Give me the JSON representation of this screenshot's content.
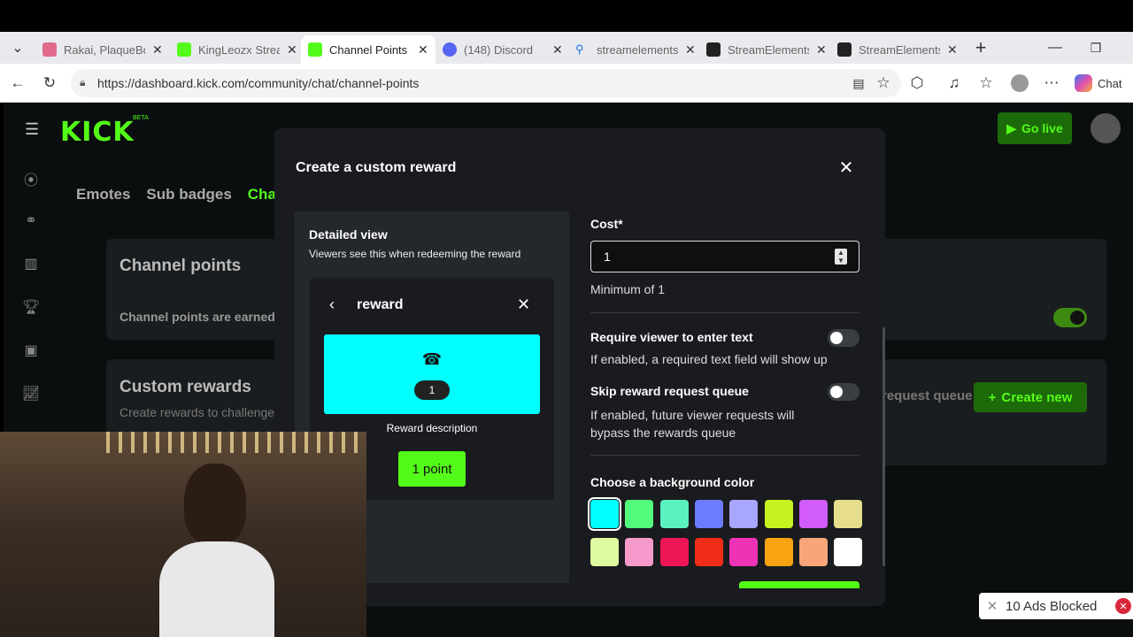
{
  "browser": {
    "tabs": [
      {
        "title": "Rakai, PlaqueBoy",
        "favicon_color": "#e06b8c"
      },
      {
        "title": "KingLeozx Stream",
        "favicon_color": "#53fc18"
      },
      {
        "title": "Channel Points",
        "favicon_color": "#53fc18"
      },
      {
        "title": "(148) Discord",
        "favicon_color": "#5865f2"
      },
      {
        "title": "streamelements",
        "favicon_color": "#1a73e8"
      },
      {
        "title": "StreamElements",
        "favicon_color": "#222222"
      },
      {
        "title": "StreamElements",
        "favicon_color": "#222222"
      }
    ],
    "url": "https://dashboard.kick.com/community/chat/channel-points",
    "chat_label": "Chat"
  },
  "page": {
    "logo": "KICK",
    "beta": "BETA",
    "go_live": "Go live",
    "tabs": [
      "Emotes",
      "Sub badges",
      "Channel points"
    ],
    "channel_points_title": "Channel points",
    "channel_points_text": "Channel points are earned",
    "custom_rewards_title": "Custom rewards",
    "custom_rewards_text": "Create rewards to challenge",
    "queue_label": "request queue",
    "create_new": "Create new"
  },
  "modal": {
    "title": "Create a custom reward",
    "detailed_view_title": "Detailed view",
    "detailed_view_sub": "Viewers see this when redeeming the reward",
    "preview": {
      "name": "reward",
      "badge": "1",
      "description": "Reward description",
      "points_button": "1 point",
      "card_color": "#00ffff"
    },
    "cost_label": "Cost*",
    "cost_value": "1",
    "cost_hint": "Minimum of 1",
    "require_text_label": "Require viewer to enter text",
    "require_text_hint": "If enabled, a required text field will show up",
    "require_text_enabled": false,
    "skip_queue_label": "Skip reward request queue",
    "skip_queue_hint": "If enabled, future viewer requests will bypass the rewards queue",
    "skip_queue_enabled": false,
    "bg_color_label": "Choose a background color",
    "colors": [
      "#00ffff",
      "#53fc7d",
      "#5cf2c0",
      "#6b7cff",
      "#a9a6ff",
      "#c6f21f",
      "#d15cf9",
      "#e6de8c",
      "#ddfaa0",
      "#f59acb",
      "#ef1655",
      "#ef2d18",
      "#ef33b6",
      "#f7a312",
      "#f8a57a",
      "#ffffff"
    ],
    "selected_color": "#00ffff"
  },
  "overlay": {
    "ads_blocked": "10 Ads Blocked"
  }
}
